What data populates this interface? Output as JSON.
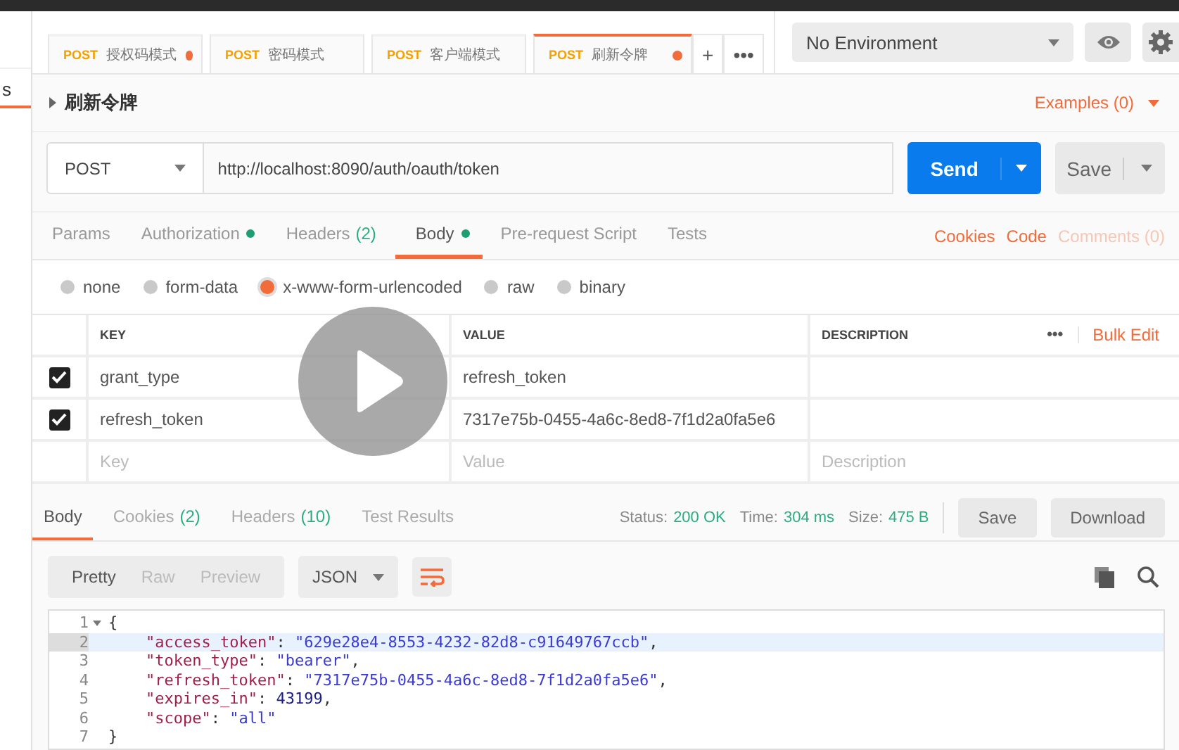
{
  "sidebar": {
    "tab": {
      "label": "s",
      "selected": true
    }
  },
  "request_tabs": [
    {
      "method": "POST",
      "title": "授权码模式",
      "unsaved": true,
      "selected": false
    },
    {
      "method": "POST",
      "title": "密码模式",
      "unsaved": false,
      "selected": false
    },
    {
      "method": "POST",
      "title": "客户端模式",
      "unsaved": false,
      "selected": false
    },
    {
      "method": "POST",
      "title": "刷新令牌",
      "unsaved": true,
      "selected": true
    }
  ],
  "tab_actions": [
    "+",
    "•••"
  ],
  "environment": {
    "value": "No Environment"
  },
  "request": {
    "name": "刷新令牌",
    "examples": "Examples (0)",
    "method": "POST",
    "url": "http://localhost:8090/auth/oauth/token",
    "send": "Send",
    "save": "Save"
  },
  "request_sections": [
    {
      "label": "Params",
      "dot": false,
      "selected": false
    },
    {
      "label": "Authorization",
      "dot": true,
      "selected": false
    },
    {
      "label": "Headers",
      "count": "(2)",
      "dot": false,
      "selected": false
    },
    {
      "label": "Body",
      "dot": true,
      "selected": true
    },
    {
      "label": "Pre-request Script",
      "dot": false,
      "selected": false
    },
    {
      "label": "Tests",
      "dot": false,
      "selected": false
    }
  ],
  "request_links": [
    {
      "label": "Cookies",
      "muted": false
    },
    {
      "label": "Code",
      "muted": false
    },
    {
      "label": "Comments (0)",
      "muted": true
    }
  ],
  "body_modes": [
    {
      "label": "none",
      "selected": false
    },
    {
      "label": "form-data",
      "selected": false
    },
    {
      "label": "x-www-form-urlencoded",
      "selected": true
    },
    {
      "label": "raw",
      "selected": false
    },
    {
      "label": "binary",
      "selected": false
    }
  ],
  "params_table": {
    "columns": [
      "KEY",
      "VALUE",
      "DESCRIPTION"
    ],
    "more": "•••",
    "bulk_edit": "Bulk Edit",
    "rows": [
      {
        "checked": true,
        "key": "grant_type",
        "value": "refresh_token",
        "description": ""
      },
      {
        "checked": true,
        "key": "refresh_token",
        "value": "7317e75b-0455-4a6c-8ed8-7f1d2a0fa5e6",
        "description": ""
      }
    ],
    "new_row": {
      "key": {
        "placeholder": "Key"
      },
      "value": {
        "placeholder": "Value"
      },
      "description": {
        "placeholder": "Description"
      }
    }
  },
  "response_tabs": [
    {
      "label": "Body",
      "selected": true
    },
    {
      "label": "Cookies",
      "count": "(2)",
      "selected": false
    },
    {
      "label": "Headers",
      "count": "(10)",
      "selected": false
    },
    {
      "label": "Test Results",
      "selected": false
    }
  ],
  "response_status": [
    {
      "label": "Status:",
      "value": "200 OK"
    },
    {
      "label": "Time:",
      "value": "304 ms"
    },
    {
      "label": "Size:",
      "value": "475 B"
    }
  ],
  "response_buttons": [
    "Save",
    "Download"
  ],
  "view_modes": [
    {
      "label": "Pretty",
      "selected": true
    },
    {
      "label": "Raw",
      "selected": false
    },
    {
      "label": "Preview",
      "selected": false
    }
  ],
  "format": "JSON",
  "code_lines": [
    {
      "number": "1",
      "fold": true,
      "active": false,
      "parts": [
        {
          "kind": "punct",
          "text": "{"
        }
      ]
    },
    {
      "number": "2",
      "fold": false,
      "active": true,
      "parts": [
        {
          "kind": "key",
          "text": "    \"access_token\""
        },
        {
          "kind": "punct",
          "text": ": "
        },
        {
          "kind": "string",
          "text": "\"629e28e4-8553-4232-82d8-c91649767ccb\""
        },
        {
          "kind": "punct",
          "text": ","
        }
      ]
    },
    {
      "number": "3",
      "fold": false,
      "active": false,
      "parts": [
        {
          "kind": "key",
          "text": "    \"token_type\""
        },
        {
          "kind": "punct",
          "text": ": "
        },
        {
          "kind": "string",
          "text": "\"bearer\""
        },
        {
          "kind": "punct",
          "text": ","
        }
      ]
    },
    {
      "number": "4",
      "fold": false,
      "active": false,
      "parts": [
        {
          "kind": "key",
          "text": "    \"refresh_token\""
        },
        {
          "kind": "punct",
          "text": ": "
        },
        {
          "kind": "string",
          "text": "\"7317e75b-0455-4a6c-8ed8-7f1d2a0fa5e6\""
        },
        {
          "kind": "punct",
          "text": ","
        }
      ]
    },
    {
      "number": "5",
      "fold": false,
      "active": false,
      "parts": [
        {
          "kind": "key",
          "text": "    \"expires_in\""
        },
        {
          "kind": "punct",
          "text": ": "
        },
        {
          "kind": "number",
          "text": "43199"
        },
        {
          "kind": "punct",
          "text": ","
        }
      ]
    },
    {
      "number": "6",
      "fold": false,
      "active": false,
      "parts": [
        {
          "kind": "key",
          "text": "    \"scope\""
        },
        {
          "kind": "punct",
          "text": ": "
        },
        {
          "kind": "string",
          "text": "\"all\""
        }
      ]
    },
    {
      "number": "7",
      "fold": false,
      "active": false,
      "parts": [
        {
          "kind": "punct",
          "text": "}"
        }
      ]
    }
  ]
}
